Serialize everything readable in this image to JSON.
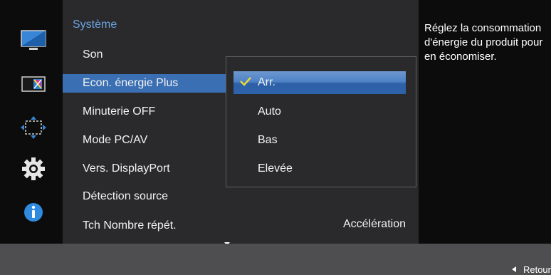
{
  "menu": {
    "title": "Système",
    "items": [
      {
        "label": "Son"
      },
      {
        "label": "Econ. énergie Plus"
      },
      {
        "label": "Minuterie OFF"
      },
      {
        "label": "Mode PC/AV"
      },
      {
        "label": "Vers. DisplayPort"
      },
      {
        "label": "Détection source"
      },
      {
        "label": "Tch Nombre répét.",
        "value": "Accélération"
      }
    ],
    "selected_index": 1
  },
  "dropdown": {
    "options": [
      "Arr.",
      "Auto",
      "Bas",
      "Elevée"
    ],
    "selected_index": 0
  },
  "help": {
    "text": "Réglez la consommation d'énergie du produit pour en économiser."
  },
  "footer": {
    "back_label": "Retour"
  },
  "side_icons": [
    "picture-icon",
    "color-icon",
    "size-position-icon",
    "setup-gear-icon",
    "information-icon"
  ],
  "colors": {
    "accent_blue": "#3a6fb3",
    "title_blue": "#6aa3e0",
    "check_yellow": "#e8d83c"
  }
}
